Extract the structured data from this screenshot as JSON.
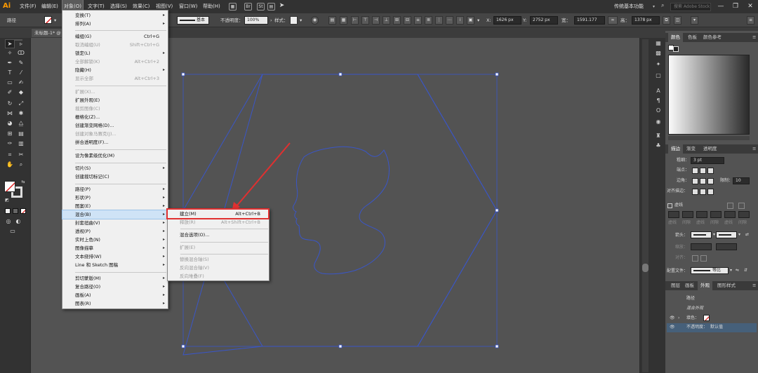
{
  "menubar": {
    "logo": "Ai",
    "items": [
      "文件(F)",
      "编辑(E)",
      "对象(O)",
      "文字(T)",
      "选择(S)",
      "效果(C)",
      "视图(V)",
      "窗口(W)",
      "帮助(H)"
    ],
    "br_label": "Br",
    "st_label": "St",
    "workspace": "传统基本功能",
    "search_placeholder": "搜索 Adobe Stock",
    "window_controls": [
      "—",
      "❐",
      "✕"
    ]
  },
  "control_bar": {
    "selection_label": "路径",
    "stroke_label": "基本",
    "opacity_label": "不透明度：",
    "opacity_value": "100%",
    "style_label": "样式：",
    "x_label": "X:",
    "x_value": "1626 px",
    "y_label": "Y:",
    "y_value": "2752 px",
    "w_label": "宽：",
    "w_value": "1591.177",
    "h_label": "高：",
    "h_value": "1378 px"
  },
  "document": {
    "tab_label": "未标题-1* @"
  },
  "object_menu": {
    "items": [
      {
        "label": "变换(T)",
        "shortcut": "",
        "submenu": true,
        "disabled": false
      },
      {
        "label": "排列(A)",
        "shortcut": "",
        "submenu": true,
        "disabled": false
      },
      {
        "sep": true
      },
      {
        "label": "编组(G)",
        "shortcut": "Ctrl+G",
        "submenu": false,
        "disabled": false
      },
      {
        "label": "取消编组(U)",
        "shortcut": "Shift+Ctrl+G",
        "submenu": false,
        "disabled": true
      },
      {
        "label": "锁定(L)",
        "shortcut": "",
        "submenu": true,
        "disabled": false
      },
      {
        "label": "全部解锁(K)",
        "shortcut": "Alt+Ctrl+2",
        "submenu": false,
        "disabled": true
      },
      {
        "label": "隐藏(H)",
        "shortcut": "",
        "submenu": true,
        "disabled": false
      },
      {
        "label": "显示全部",
        "shortcut": "Alt+Ctrl+3",
        "submenu": false,
        "disabled": true
      },
      {
        "sep": true
      },
      {
        "label": "扩展(X)...",
        "shortcut": "",
        "submenu": false,
        "disabled": true
      },
      {
        "label": "扩展外观(E)",
        "shortcut": "",
        "submenu": false,
        "disabled": false
      },
      {
        "label": "裁剪图像(C)",
        "shortcut": "",
        "submenu": false,
        "disabled": true
      },
      {
        "label": "栅格化(Z)...",
        "shortcut": "",
        "submenu": false,
        "disabled": false
      },
      {
        "label": "创建渐变网格(D)...",
        "shortcut": "",
        "submenu": false,
        "disabled": false
      },
      {
        "label": "创建对象马赛克(J)...",
        "shortcut": "",
        "submenu": false,
        "disabled": true
      },
      {
        "label": "拼合透明度(F)...",
        "shortcut": "",
        "submenu": false,
        "disabled": false
      },
      {
        "sep": true
      },
      {
        "label": "设为像素级优化(M)",
        "shortcut": "",
        "submenu": false,
        "disabled": false
      },
      {
        "sep": true
      },
      {
        "label": "切片(S)",
        "shortcut": "",
        "submenu": true,
        "disabled": false
      },
      {
        "label": "创建裁切标记(C)",
        "shortcut": "",
        "submenu": false,
        "disabled": false
      },
      {
        "sep": true
      },
      {
        "label": "路径(P)",
        "shortcut": "",
        "submenu": true,
        "disabled": false
      },
      {
        "label": "形状(P)",
        "shortcut": "",
        "submenu": true,
        "disabled": false
      },
      {
        "label": "图案(E)",
        "shortcut": "",
        "submenu": true,
        "disabled": false
      },
      {
        "label": "混合(B)",
        "shortcut": "",
        "submenu": true,
        "disabled": false,
        "highlighted": true
      },
      {
        "label": "封套扭曲(V)",
        "shortcut": "",
        "submenu": true,
        "disabled": false
      },
      {
        "label": "透视(P)",
        "shortcut": "",
        "submenu": true,
        "disabled": false
      },
      {
        "label": "实时上色(N)",
        "shortcut": "",
        "submenu": true,
        "disabled": false
      },
      {
        "label": "图像描摹",
        "shortcut": "",
        "submenu": true,
        "disabled": false
      },
      {
        "label": "文本绕排(W)",
        "shortcut": "",
        "submenu": true,
        "disabled": false
      },
      {
        "label": "Line 和 Sketch 图稿",
        "shortcut": "",
        "submenu": true,
        "disabled": false
      },
      {
        "sep": true
      },
      {
        "label": "剪切蒙版(M)",
        "shortcut": "",
        "submenu": true,
        "disabled": false
      },
      {
        "label": "复合路径(O)",
        "shortcut": "",
        "submenu": true,
        "disabled": false
      },
      {
        "label": "画板(A)",
        "shortcut": "",
        "submenu": true,
        "disabled": false
      },
      {
        "label": "图表(R)",
        "shortcut": "",
        "submenu": true,
        "disabled": false
      }
    ]
  },
  "blend_submenu": {
    "items": [
      {
        "label": "建立(M)",
        "shortcut": "Alt+Ctrl+B",
        "disabled": false
      },
      {
        "label": "释放(R)",
        "shortcut": "Alt+Shift+Ctrl+B",
        "disabled": true
      },
      {
        "sep": true
      },
      {
        "label": "混合选项(O)...",
        "shortcut": "",
        "disabled": false
      },
      {
        "sep": true
      },
      {
        "label": "扩展(E)",
        "shortcut": "",
        "disabled": true
      },
      {
        "sep": true
      },
      {
        "label": "替换混合轴(S)",
        "shortcut": "",
        "disabled": true
      },
      {
        "label": "反向混合轴(V)",
        "shortcut": "",
        "disabled": true
      },
      {
        "label": "反向堆叠(F)",
        "shortcut": "",
        "disabled": true
      }
    ]
  },
  "color_panel": {
    "tabs": [
      "颜色",
      "色板",
      "颜色参考"
    ]
  },
  "stroke_panel": {
    "tabs": [
      "描边",
      "渐变",
      "透明度"
    ],
    "weight_label": "粗细：",
    "weight_value": "3 pt",
    "cap_label": "端点：",
    "corner_label": "边角：",
    "limit_label": "限制：",
    "limit_value": "10",
    "align_label": "对齐描边：",
    "dashed_label": "虚线",
    "dash_labels": [
      "虚线",
      "间隙",
      "虚线",
      "间隙",
      "虚线",
      "间隙"
    ],
    "arrow_label": "箭头：",
    "scale_label": "缩放：",
    "align2_label": "对齐：",
    "profile_label": "配置文件：",
    "profile_value": "等比"
  },
  "appearance_panel": {
    "tabs": [
      "图层",
      "画板",
      "外观",
      "图形样式"
    ],
    "path_label": "路径",
    "blend_label": "混合外观",
    "fill_label": "填色：",
    "opacity_label": "不透明度：",
    "opacity_value": "默认值"
  },
  "colors": {
    "selection": "#3a56c8",
    "highlight_box": "#e03030",
    "menu_highlight": "#cfe3f6"
  }
}
